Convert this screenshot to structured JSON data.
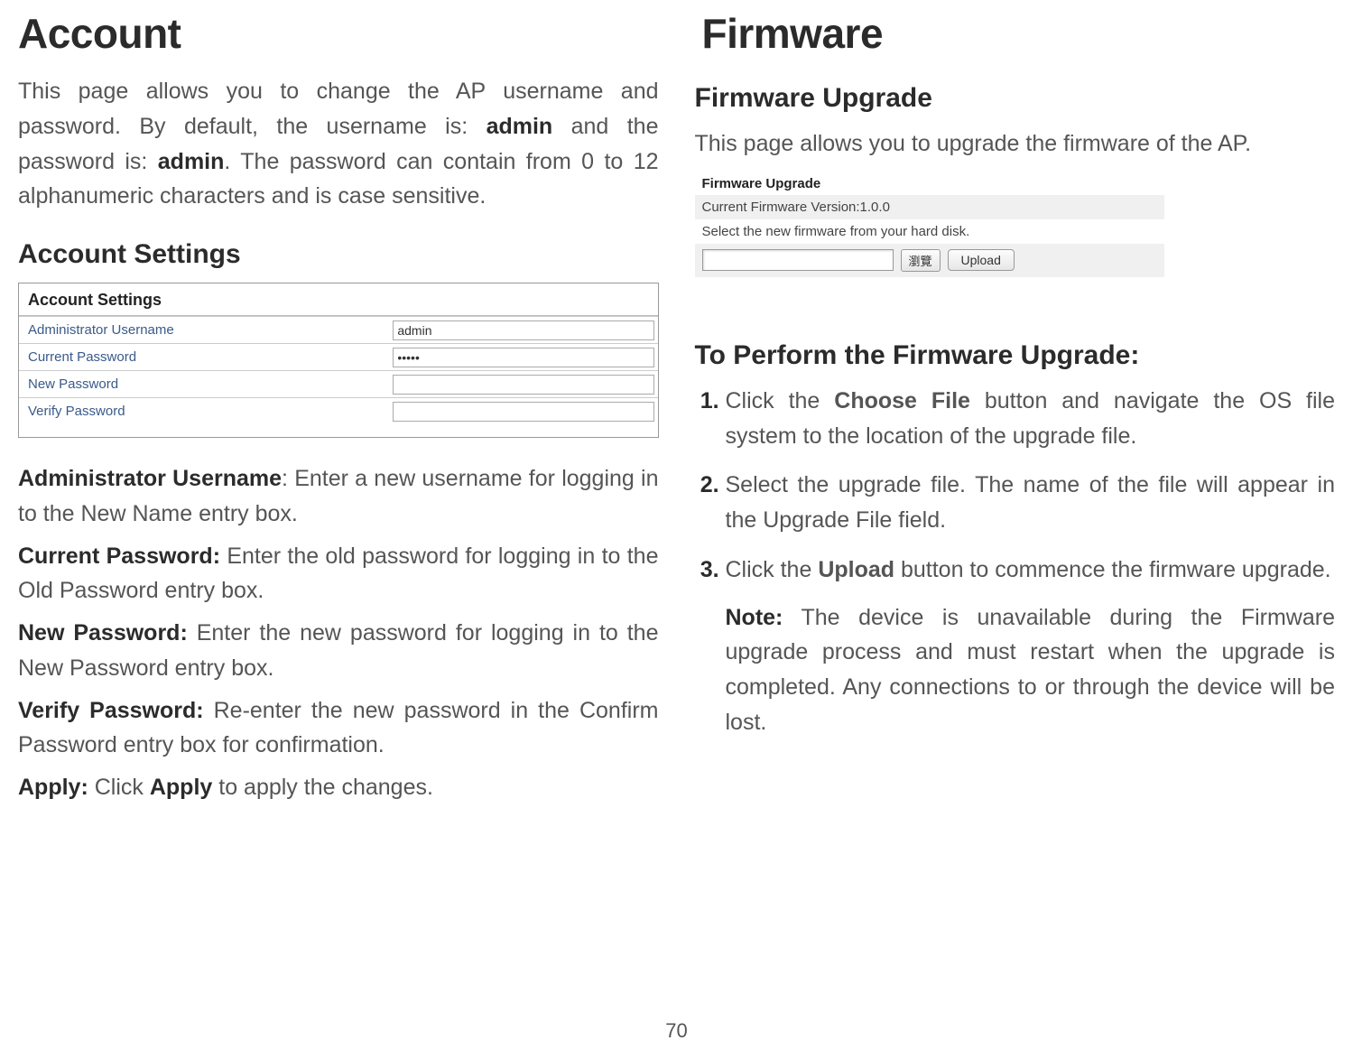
{
  "left": {
    "title": "Account",
    "intro_parts": {
      "p1": "This page allows you to change the AP username and password. By default, the username is: ",
      "b1": "admin",
      "p2": " and the password is: ",
      "b2": "admin",
      "p3": ". The password can contain from 0 to 12 alphanumeric characters and is case sensitive."
    },
    "settings_heading": "Account Settings",
    "table": {
      "header": "Account Settings",
      "rows": [
        {
          "label": "Administrator Username",
          "value": "admin",
          "type": "input"
        },
        {
          "label": "Current Password",
          "value": "•••••",
          "type": "password"
        },
        {
          "label": "New Password",
          "value": "",
          "type": "input"
        },
        {
          "label": "Verify Password",
          "value": "",
          "type": "input"
        }
      ]
    },
    "desc": {
      "admin_user_b": "Administrator Username",
      "admin_user_t": ": Enter a new username for logging in to the New Name entry box.",
      "cur_pw_b": "Current Password:",
      "cur_pw_t": " Enter the old password for logging in to the Old Password entry box.",
      "new_pw_b": "New Password:",
      "new_pw_t": " Enter the new password for logging in to the New Password entry box.",
      "ver_pw_b": "Verify Password:",
      "ver_pw_t": " Re-enter the new password in the Confirm Password entry box for confirmation.",
      "apply_b": "Apply:",
      "apply_t1": " Click ",
      "apply_b2": "Apply",
      "apply_t2": " to apply the changes."
    }
  },
  "right": {
    "title": "Firmware",
    "upgrade_heading": "Firmware Upgrade",
    "intro": "This page allows you to upgrade the firmware of the AP.",
    "screenshot": {
      "header": "Firmware Upgrade",
      "row1": "Current Firmware Version:1.0.0",
      "row2": "Select the new firmware from your hard disk.",
      "browse": "瀏覽",
      "upload": "Upload"
    },
    "perform_heading": "To Perform the Firmware Upgrade:",
    "steps": {
      "s1a": "Click the ",
      "s1b": "Choose File",
      "s1c": " button and navigate the OS file system to the location of the upgrade file.",
      "s2": "Select the upgrade file. The name of the file will appear in the Upgrade File field.",
      "s3a": "Click the ",
      "s3b": "Upload",
      "s3c": " button to commence the firmware upgrade.",
      "note_b": "Note:",
      "note_t": " The device is unavailable during the Firmware upgrade process and must restart when the upgrade is completed. Any connections to or through the device will be lost."
    }
  },
  "page_number": "70"
}
